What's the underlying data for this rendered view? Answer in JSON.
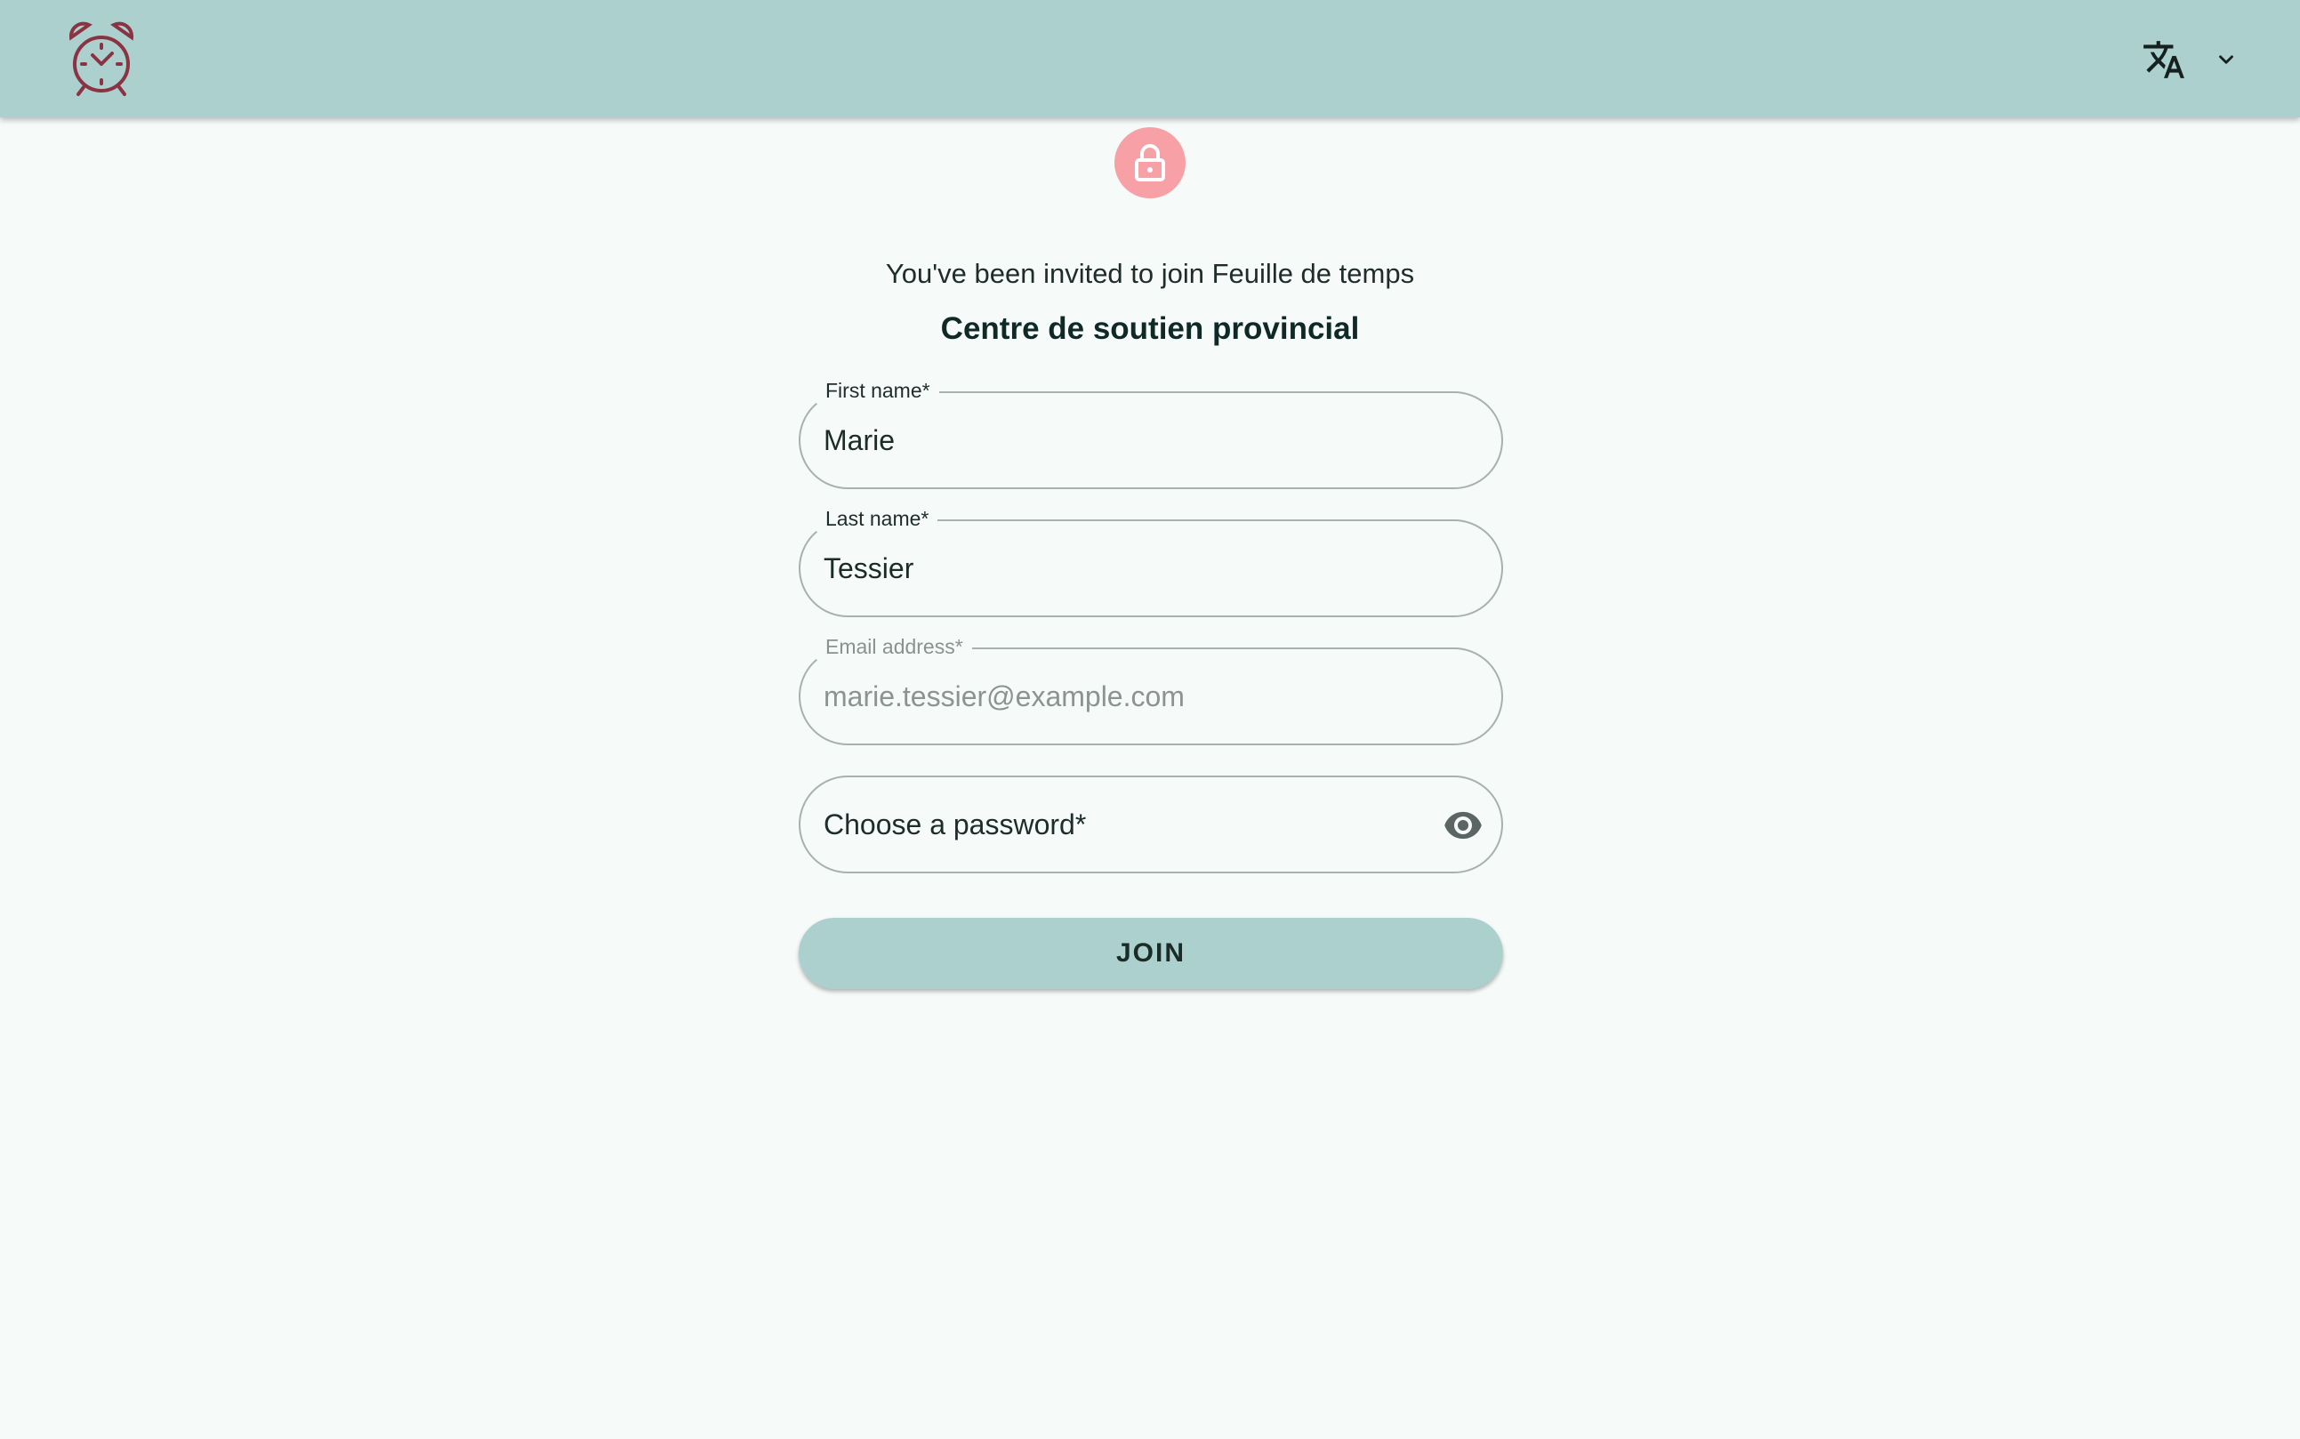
{
  "header": {
    "logo_icon": "alarm-clock-icon",
    "language_icon": "translate-icon",
    "language_menu_icon": "chevron-down-icon"
  },
  "invite": {
    "lock_icon": "lock-icon",
    "message": "You've been invited to join Feuille de temps",
    "organization": "Centre de soutien provincial"
  },
  "form": {
    "first_name": {
      "label": "First name*",
      "value": "Marie"
    },
    "last_name": {
      "label": "Last name*",
      "value": "Tessier"
    },
    "email": {
      "label": "Email address*",
      "value": "marie.tessier@example.com"
    },
    "password": {
      "placeholder": "Choose a password*",
      "toggle_icon": "eye-icon"
    },
    "submit_label": "JOIN"
  },
  "colors": {
    "header_bg": "#acd0cd",
    "page_bg": "#f6faf9",
    "lock_badge": "#f7a0a6",
    "logo": "#8a3343",
    "button_bg": "#acd0cd"
  }
}
